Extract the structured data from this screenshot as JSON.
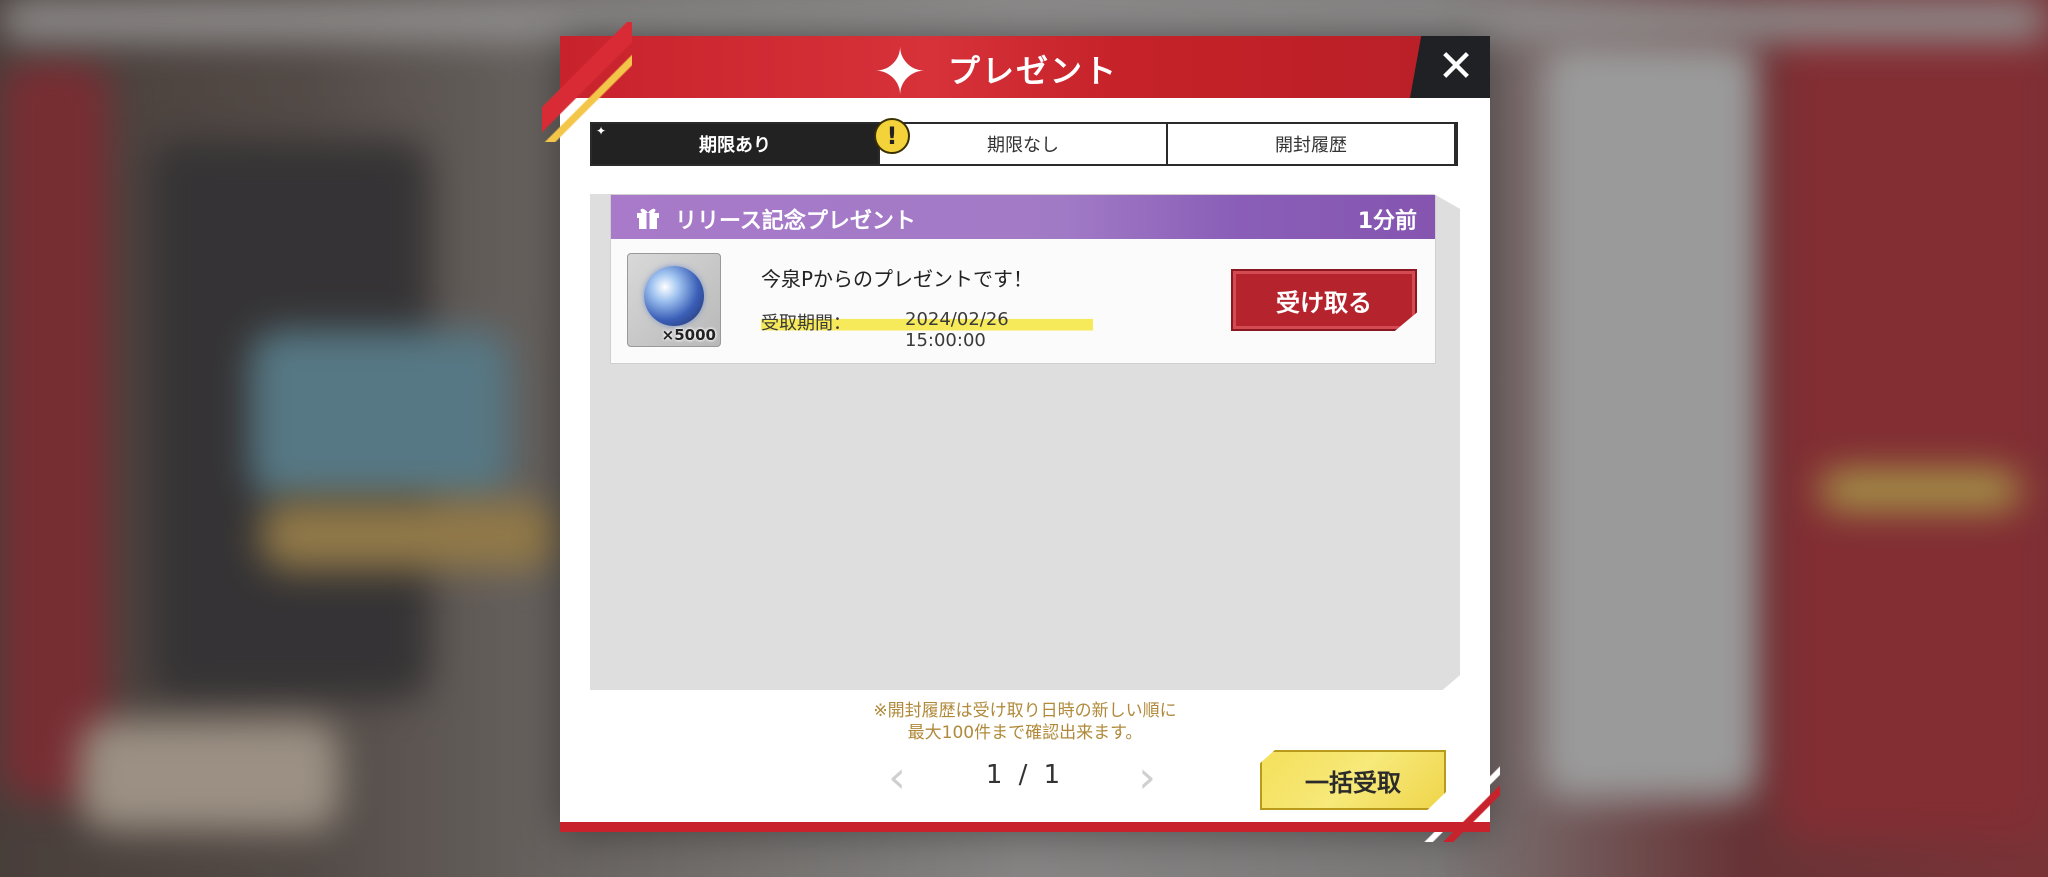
{
  "header": {
    "title": "プレゼント",
    "star_icon": "sparkle-icon",
    "close_icon": "close-icon"
  },
  "tabs": [
    {
      "label": "期限あり",
      "active": true,
      "badge": "!"
    },
    {
      "label": "期限なし",
      "active": false
    },
    {
      "label": "開封履歴",
      "active": false
    }
  ],
  "items": [
    {
      "title": "リリース記念プレゼント",
      "time": "1分前",
      "quantity": "×5000",
      "message": "今泉Pからのプレゼントです！",
      "deadline_label": "受取期間：",
      "deadline_value": "2024/02/26 15:00:00",
      "receive_label": "受け取る",
      "icon": "gift-icon"
    }
  ],
  "footer": {
    "note_line1": "※開封履歴は受け取り日時の新しい順に",
    "note_line2": "最大100件まで確認出来ます。",
    "page": "1 / 1",
    "prev_icon": "chevron-left-icon",
    "next_icon": "chevron-right-icon",
    "bulk_label": "一括受取"
  },
  "colors": {
    "header_red": "#c8222c",
    "item_header_purple": "#a87ac9",
    "receive_button": "#b5232d",
    "bulk_button": "#f4e05a",
    "highlight_yellow": "#f6ea5a"
  }
}
